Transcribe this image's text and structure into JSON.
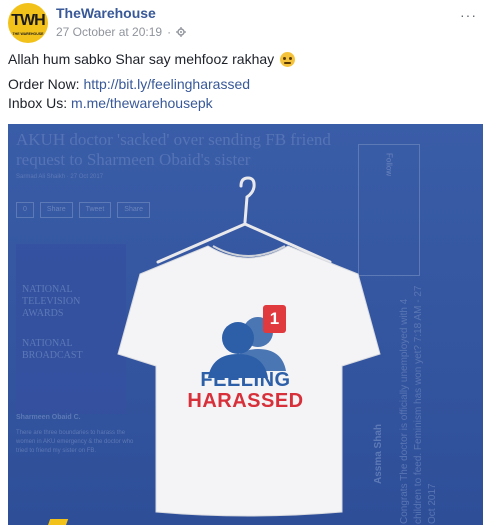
{
  "post": {
    "page_name": "TheWarehouse",
    "logo_text": "TWH",
    "logo_subtext": "THE WAREHOUSE",
    "timestamp": "27 October at 20:19",
    "privacy_icon": "settings-gear-icon",
    "more_icon": "more-options-icon",
    "more_label": "···",
    "message_line": "Allah hum sabko Shar say mehfooz rakhay",
    "message_emoji": "persevering-face-emoji",
    "order_label": "Order Now:",
    "order_link": "http://bit.ly/feelingharassed",
    "inbox_label": "Inbox Us:",
    "inbox_link": "m.me/thewarehousepk"
  },
  "image": {
    "bg_headline": "AKUH doctor 'sacked' over sending FB friend request to Sharmeen Obaid's sister",
    "bg_byline": "Sarmad Ali Shaikh · 27 Oct 2017",
    "bg_share_buttons": [
      "0",
      "Share",
      "Tweet",
      "Share"
    ],
    "bg_follow": "Follow",
    "bg_tv_text": "NATIONAL TELEVISION AWARDS",
    "bg_tv_text_2": "NATIONAL BROADCAST",
    "bg_comment_name": "Sharmeen Obaid C.",
    "bg_comment_text": "There are three boundaries to harass the women in AKU emergency & the doctor who tried to friend my sister on FB.",
    "bg_side_name": "Assma Shah",
    "bg_side_text": "Congrats The doctor is officially unemployed with 4 children to feed. Feminism has won yet? 7:18 AM - 27 Oct 2017",
    "shirt_line_1": "FEELING",
    "shirt_line_2": "HARASSED",
    "notification_count": "1",
    "colors": {
      "background": "#2e4e98",
      "shirt_blue": "#2d5fa8",
      "shirt_red": "#d8303a",
      "badge": "#e0393e"
    }
  }
}
